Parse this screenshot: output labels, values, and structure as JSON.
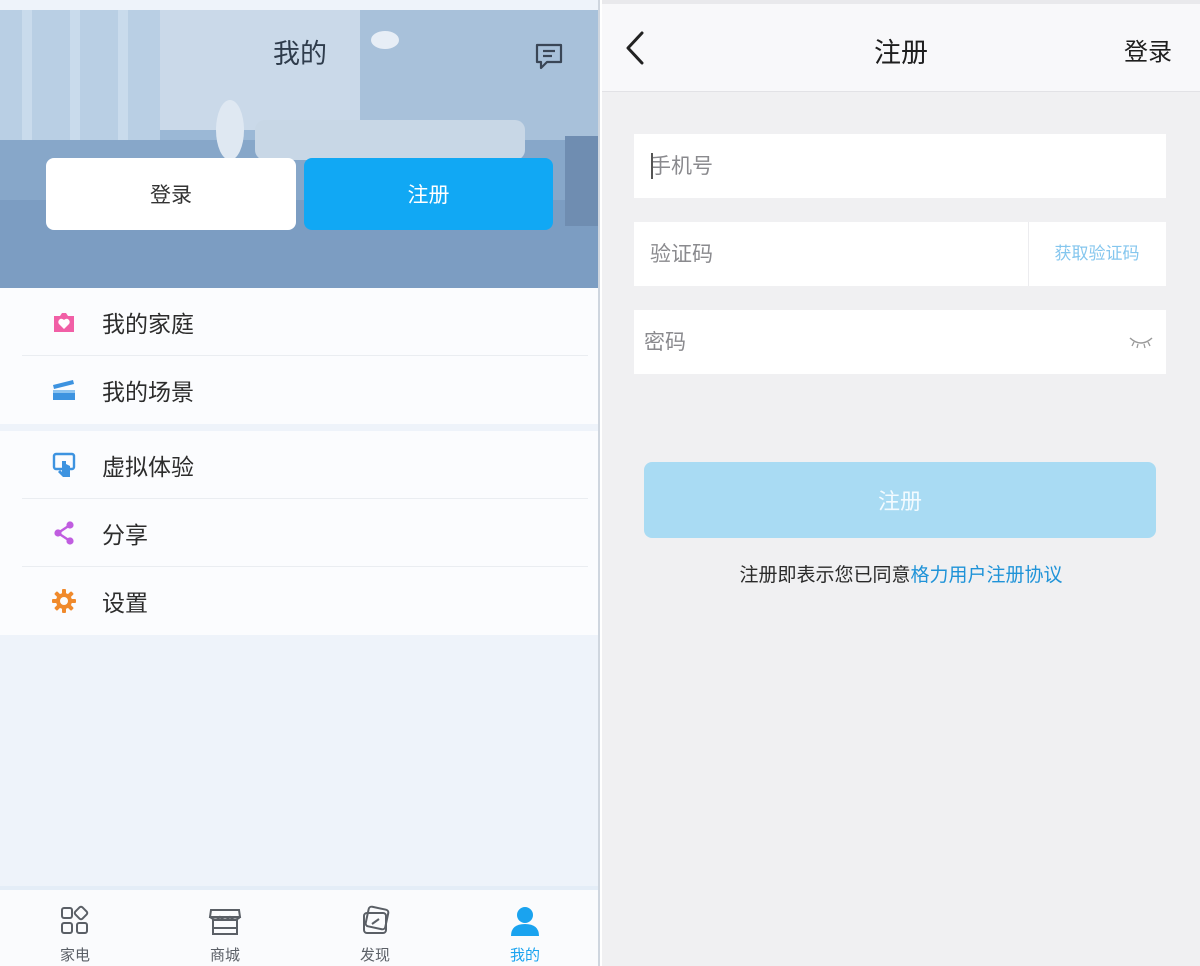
{
  "left": {
    "title": "我的",
    "login_label": "登录",
    "register_label": "注册",
    "menu_group_1": [
      {
        "label": "我的家庭",
        "icon": "home-heart-icon",
        "color": "#f15fa6"
      },
      {
        "label": "我的场景",
        "icon": "clapperboard-icon",
        "color": "#3d93e0"
      }
    ],
    "menu_group_2": [
      {
        "label": "虚拟体验",
        "icon": "touch-screen-icon",
        "color": "#3d93e0"
      },
      {
        "label": "分享",
        "icon": "share-icon",
        "color": "#c05de0"
      },
      {
        "label": "设置",
        "icon": "gear-icon",
        "color": "#f08a2c"
      }
    ],
    "tabs": [
      {
        "label": "家电",
        "icon": "appliances-grid-icon",
        "active": false
      },
      {
        "label": "商城",
        "icon": "store-icon",
        "active": false
      },
      {
        "label": "发现",
        "icon": "discover-icon",
        "active": false
      },
      {
        "label": "我的",
        "icon": "user-icon",
        "active": true
      }
    ]
  },
  "right": {
    "title": "注册",
    "login_link": "登录",
    "phone_placeholder": "手机号",
    "code_placeholder": "验证码",
    "get_code_label": "获取验证码",
    "password_placeholder": "密码",
    "submit_label": "注册",
    "agreement_prefix": "注册即表示您已同意",
    "agreement_link": "格力用户注册协议"
  },
  "colors": {
    "primary": "#11a8f4",
    "submit_disabled": "#a9dbf3",
    "link": "#1f93d8",
    "tab_active": "#1aa3ef"
  }
}
